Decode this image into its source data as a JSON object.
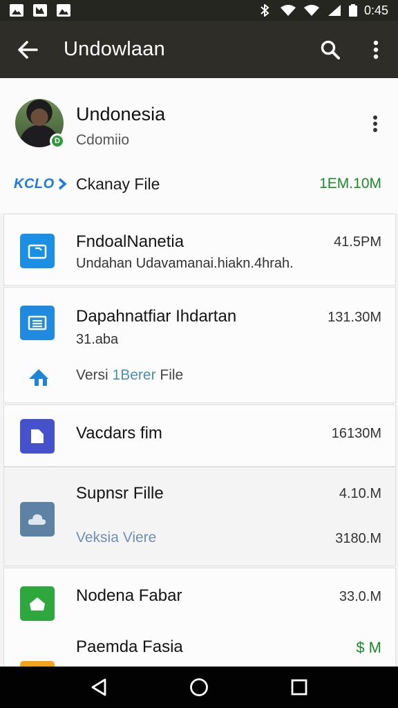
{
  "status_bar": {
    "time": "0:45",
    "icons": [
      "image-icon",
      "gallery-icon",
      "image-icon",
      "bluetooth-icon",
      "wifi-icon",
      "signal-icon",
      "battery-icon"
    ]
  },
  "app_bar": {
    "title": "Undowlaan",
    "icons": [
      "back-arrow-icon",
      "search-icon",
      "more-vert-icon"
    ]
  },
  "profile": {
    "name": "Undonesia",
    "subtitle": "Cdomiio",
    "badge": "D",
    "link_logo": "KCLO",
    "link_label": "Ckanay File",
    "link_size": "1EM.10M"
  },
  "files": [
    {
      "title": "FndoalNanetia",
      "subtitle": "Undahan Udavamanai.hiakn.4hrah.",
      "size": "41.5PM",
      "icon": "folder-photo-icon",
      "icon_color": "#1a8fe3"
    },
    {
      "title": "Dapahnatfiar Ihdartan",
      "subtitle": "31.aba",
      "size": "131.30M",
      "icon": "document-icon",
      "icon_color": "#1f8ae0",
      "link_prefix": "Versi ",
      "link_highlight": "1Berer",
      "link_suffix": " File",
      "link_icon": "upload-cloud-icon"
    },
    {
      "title": "Vacdars fim",
      "size": "16130M",
      "icon": "file-icon",
      "icon_color": "#4552cc"
    },
    {
      "title": "Supnsr Fille",
      "size": "4.10.M",
      "size2": "3180.M",
      "link": "Veksia Viere",
      "icon": "cloud-icon",
      "icon_color": "#5e82a3"
    },
    {
      "title": "Nodena Fabar",
      "size": "33.0.M",
      "icon": "bag-icon",
      "icon_color": "#2ea83d"
    },
    {
      "title": "Paemda Fasia",
      "size": "$ M",
      "icon": "file-icon",
      "icon_color": "#f3a318"
    }
  ],
  "nav": [
    "back-triangle-icon",
    "home-circle-icon",
    "recents-square-icon"
  ]
}
